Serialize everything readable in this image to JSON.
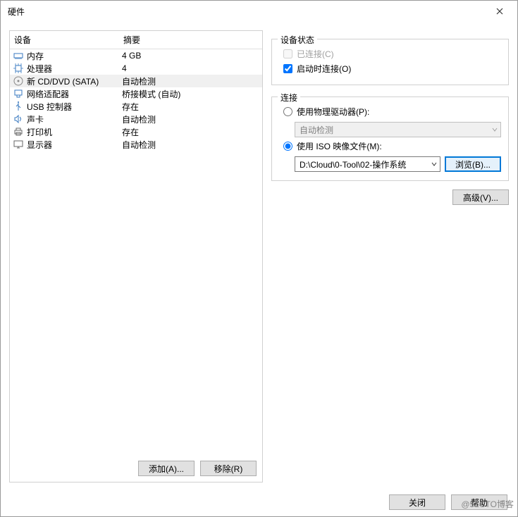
{
  "window": {
    "title": "硬件"
  },
  "listHeader": {
    "device": "设备",
    "summary": "摘要"
  },
  "devices": [
    {
      "name": "内存",
      "summary": "4 GB",
      "icon": "memory-icon",
      "selected": false
    },
    {
      "name": "处理器",
      "summary": "4",
      "icon": "cpu-icon",
      "selected": false
    },
    {
      "name": "新 CD/DVD (SATA)",
      "summary": "自动检测",
      "icon": "cd-icon",
      "selected": true
    },
    {
      "name": "网络适配器",
      "summary": "桥接模式 (自动)",
      "icon": "network-icon",
      "selected": false
    },
    {
      "name": "USB 控制器",
      "summary": "存在",
      "icon": "usb-icon",
      "selected": false
    },
    {
      "name": "声卡",
      "summary": "自动检测",
      "icon": "sound-icon",
      "selected": false
    },
    {
      "name": "打印机",
      "summary": "存在",
      "icon": "printer-icon",
      "selected": false
    },
    {
      "name": "显示器",
      "summary": "自动检测",
      "icon": "display-icon",
      "selected": false
    }
  ],
  "leftButtons": {
    "add": "添加(A)...",
    "remove": "移除(R)"
  },
  "status": {
    "legend": "设备状态",
    "connected": {
      "label": "已连接(C)",
      "checked": false,
      "enabled": false
    },
    "connectAtStart": {
      "label": "启动时连接(O)",
      "checked": true
    }
  },
  "connection": {
    "legend": "连接",
    "physical": {
      "label": "使用物理驱动器(P):",
      "selected": false,
      "value": "自动检测"
    },
    "iso": {
      "label": "使用 ISO 映像文件(M):",
      "selected": true,
      "value": "D:\\Cloud\\0-Tool\\02-操作系统",
      "browse": "浏览(B)..."
    }
  },
  "advanced": "高级(V)...",
  "footer": {
    "close": "关闭",
    "help": "帮助"
  },
  "watermark": "@51CTO博客"
}
